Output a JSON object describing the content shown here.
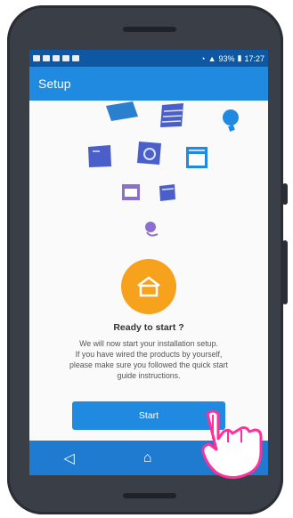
{
  "status_bar": {
    "battery": "93%",
    "time": "17:27"
  },
  "app_bar": {
    "title": "Setup"
  },
  "content": {
    "headline": "Ready to start ?",
    "description_lines": [
      "We will now start your installation setup.",
      "If you have wired the products by yourself,",
      "please make sure you followed the quick start",
      "guide instructions."
    ],
    "start_label": "Start"
  },
  "navigation": {
    "back": "back-icon",
    "home": "home-icon",
    "recent": "recent-apps-icon"
  },
  "colors": {
    "status": "#0d57a3",
    "appbar": "#1f8ae0",
    "nav": "#1f7bd0",
    "accent": "#f6a21c",
    "hand": "#ff2f9b"
  }
}
